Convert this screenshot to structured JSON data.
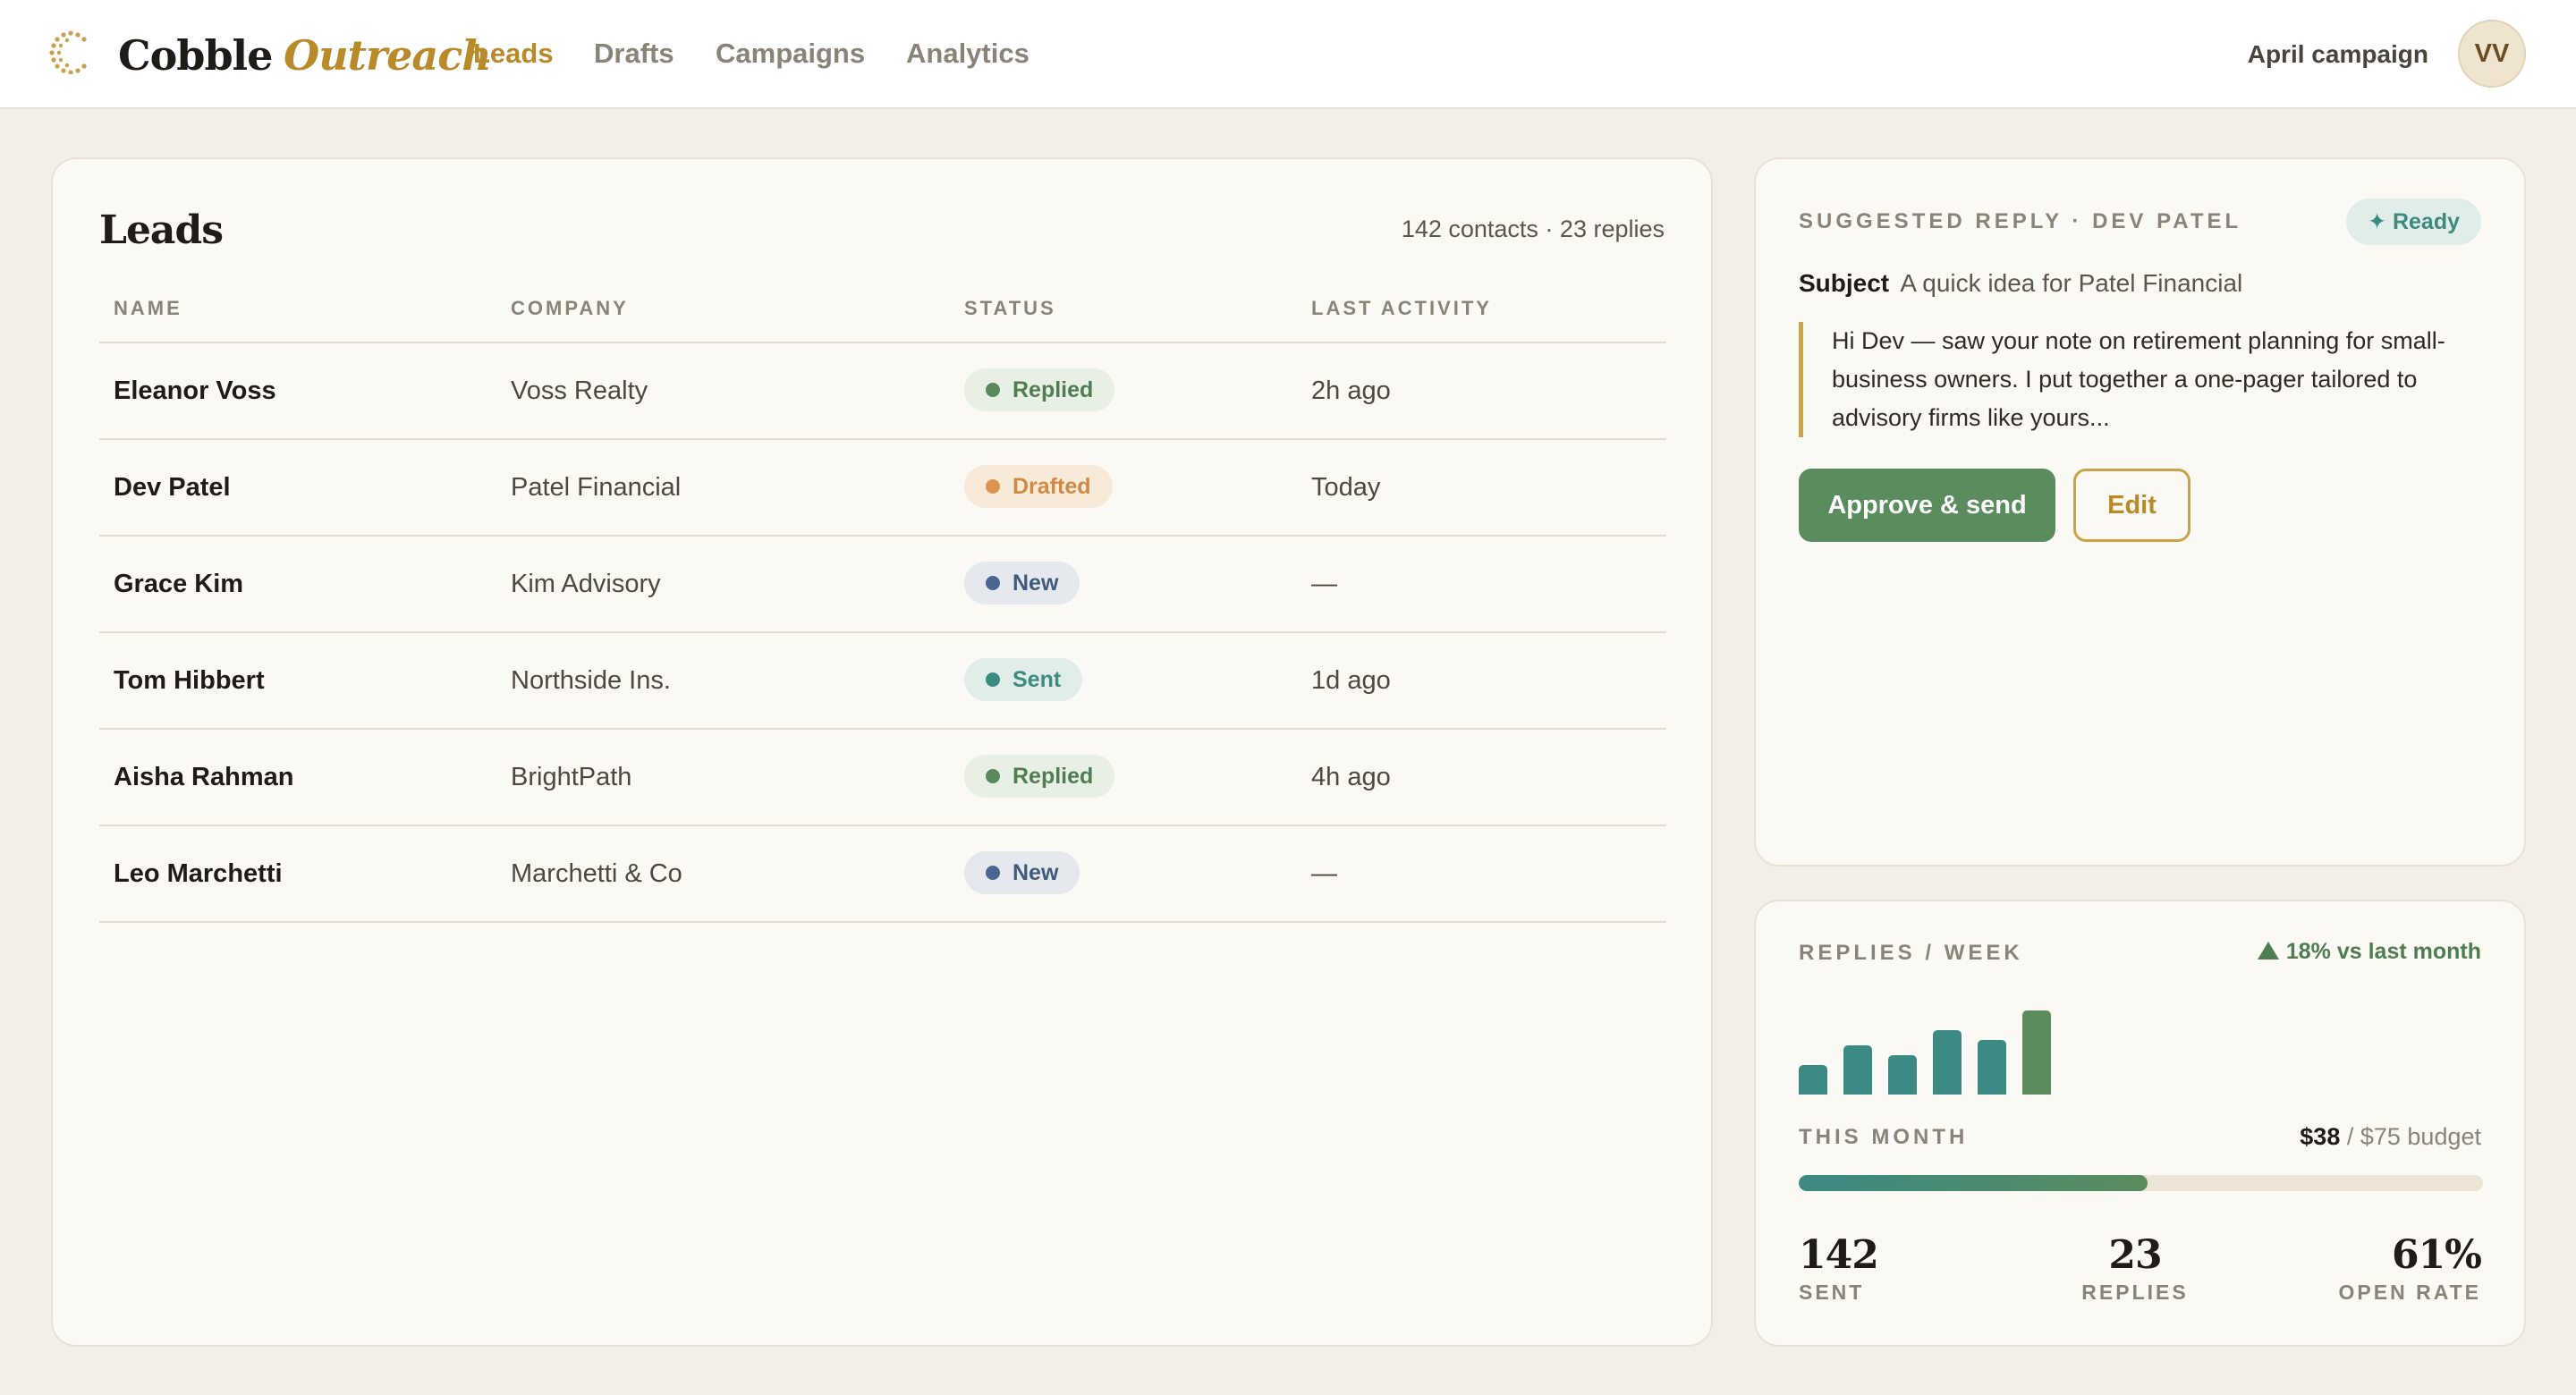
{
  "brand": {
    "name_part1": "Cobble",
    "name_part2": "Outreach",
    "accent": "#b88a2a"
  },
  "nav": {
    "items": [
      {
        "label": "Leads",
        "active": true
      },
      {
        "label": "Drafts",
        "active": false
      },
      {
        "label": "Campaigns",
        "active": false
      },
      {
        "label": "Analytics",
        "active": false
      }
    ]
  },
  "header": {
    "campaign": "April campaign",
    "avatar_initials": "VV"
  },
  "leads": {
    "title": "Leads",
    "summary": "142 contacts · 23 replies",
    "columns": [
      "NAME",
      "COMPANY",
      "STATUS",
      "LAST ACTIVITY"
    ],
    "rows": [
      {
        "name": "Eleanor Voss",
        "company": "Voss Realty",
        "status": "Replied",
        "activity": "2h ago"
      },
      {
        "name": "Dev Patel",
        "company": "Patel Financial",
        "status": "Drafted",
        "activity": "Today"
      },
      {
        "name": "Grace Kim",
        "company": "Kim Advisory",
        "status": "New",
        "activity": "—"
      },
      {
        "name": "Tom Hibbert",
        "company": "Northside Ins.",
        "status": "Sent",
        "activity": "1d ago"
      },
      {
        "name": "Aisha Rahman",
        "company": "BrightPath",
        "status": "Replied",
        "activity": "4h ago"
      },
      {
        "name": "Leo Marchetti",
        "company": "Marchetti & Co",
        "status": "New",
        "activity": "—"
      }
    ]
  },
  "reply": {
    "heading": "SUGGESTED REPLY · DEV PATEL",
    "badge": "✦ Ready",
    "subject_label": "Subject",
    "subject": "A quick idea for Patel Financial",
    "body": "Hi Dev — saw your note on retirement planning for small-business owners. I put together a one-pager tailored to advisory firms like yours...",
    "approve_label": "Approve & send",
    "edit_label": "Edit"
  },
  "stats": {
    "heading": "REPLIES / WEEK",
    "trend": "18% vs last month",
    "weekly_replies": [
      3,
      5,
      4,
      6.5,
      5.5,
      8.5
    ],
    "month_label": "THIS MONTH",
    "budget_spent": "$38",
    "budget_total": "/ $75 budget",
    "budget_fraction": 0.51,
    "metrics": [
      {
        "value": "142",
        "label": "SENT"
      },
      {
        "value": "23",
        "label": "REPLIES"
      },
      {
        "value": "61%",
        "label": "OPEN RATE"
      }
    ]
  },
  "colors": {
    "replied": "#5a8a5c",
    "drafted": "#de9351",
    "new": "#4a6690",
    "sent": "#3a8c80",
    "primary_button": "#5b8c5e"
  }
}
